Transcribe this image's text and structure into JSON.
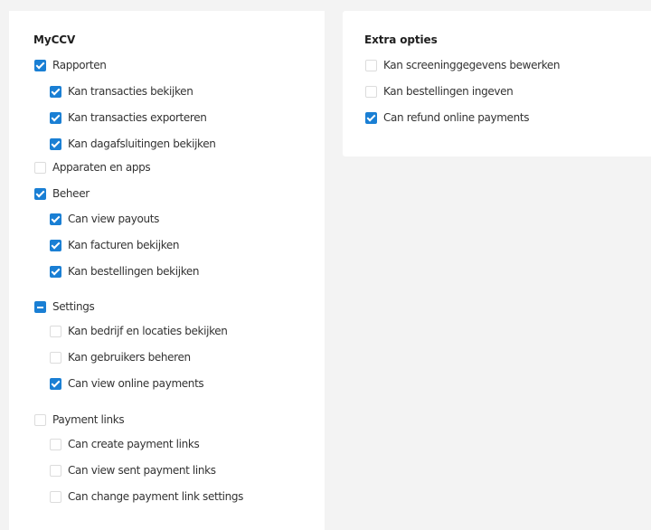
{
  "left_panel": {
    "title": "MyCCV",
    "rows": [
      {
        "label": "Rapporten",
        "state": "checked",
        "level": 0
      },
      {
        "label": "Kan transacties bekijken",
        "state": "checked",
        "level": 1
      },
      {
        "label": "Kan transacties exporteren",
        "state": "checked",
        "level": 1
      },
      {
        "label": "Kan dagafsluitingen bekijken",
        "state": "checked",
        "level": 1
      },
      {
        "label": "Apparaten en apps",
        "state": "unchecked",
        "level": 0
      },
      {
        "label": "Beheer",
        "state": "checked",
        "level": 0
      },
      {
        "label": "Can view payouts",
        "state": "checked",
        "level": 1
      },
      {
        "label": "Kan facturen bekijken",
        "state": "checked",
        "level": 1
      },
      {
        "label": "Kan bestellingen bekijken",
        "state": "checked",
        "level": 1
      },
      {
        "label": "Settings",
        "state": "partial",
        "level": 0
      },
      {
        "label": "Kan bedrijf en locaties bekijken",
        "state": "unchecked",
        "level": 1
      },
      {
        "label": "Kan gebruikers beheren",
        "state": "unchecked",
        "level": 1
      },
      {
        "label": "Can view online payments",
        "state": "checked",
        "level": 1
      },
      {
        "label": "Payment links",
        "state": "unchecked",
        "level": 0
      },
      {
        "label": "Can create payment links",
        "state": "unchecked",
        "level": 1
      },
      {
        "label": "Can view sent payment links",
        "state": "unchecked",
        "level": 1
      },
      {
        "label": "Can change payment link settings",
        "state": "unchecked",
        "level": 1
      }
    ]
  },
  "right_panel": {
    "title": "Extra opties",
    "rows": [
      {
        "label": "Kan screeninggegevens bewerken",
        "state": "unchecked",
        "level": 0
      },
      {
        "label": "Kan bestellingen ingeven",
        "state": "unchecked",
        "level": 0
      },
      {
        "label": "Can refund online payments",
        "state": "checked",
        "level": 0
      }
    ]
  },
  "colors": {
    "accent": "#1a7fd4",
    "background": "#f3f3f3",
    "card": "#ffffff"
  }
}
